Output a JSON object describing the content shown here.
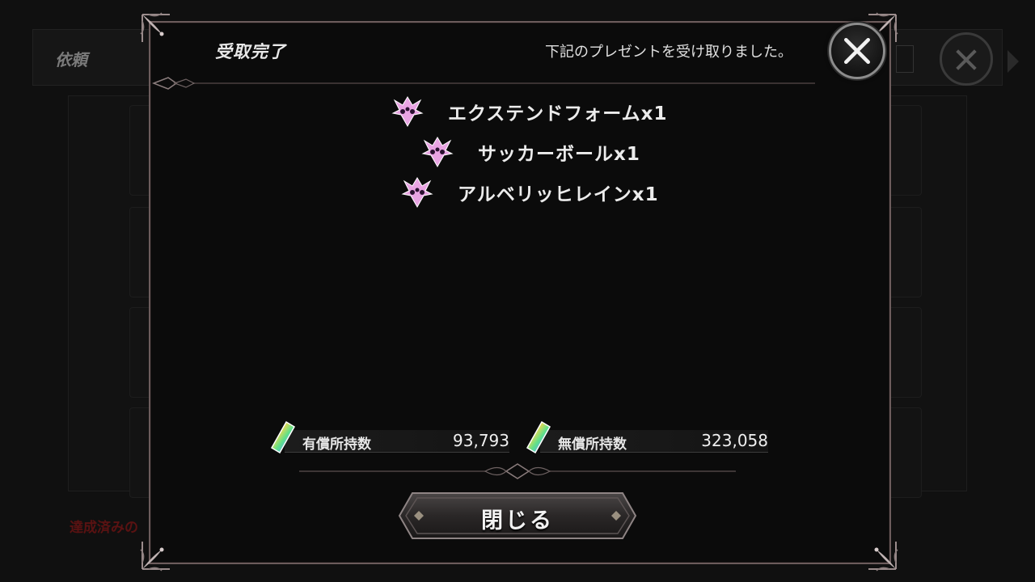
{
  "background": {
    "title": "依頼",
    "footer_note": "達成済みの"
  },
  "modal": {
    "title": "受取完了",
    "message": "下記のプレゼントを受け取りました。",
    "close_icon": "close-icon",
    "rewards": [
      {
        "label": "エクステンドフォームx1",
        "icon": "skill-emblem-icon"
      },
      {
        "label": "サッカーボールx1",
        "icon": "skill-emblem-icon"
      },
      {
        "label": "アルベリッヒレインx1",
        "icon": "skill-emblem-icon"
      }
    ],
    "currencies": [
      {
        "label": "有償所持数",
        "value": "93,793",
        "icon": "crystal-icon"
      },
      {
        "label": "無償所持数",
        "value": "323,058",
        "icon": "crystal-icon"
      }
    ],
    "close_button_label": "閉じる"
  },
  "colors": {
    "frame": "#6c5c5c",
    "emblem": "#f0a8e8",
    "warning_text": "#5a1212"
  }
}
